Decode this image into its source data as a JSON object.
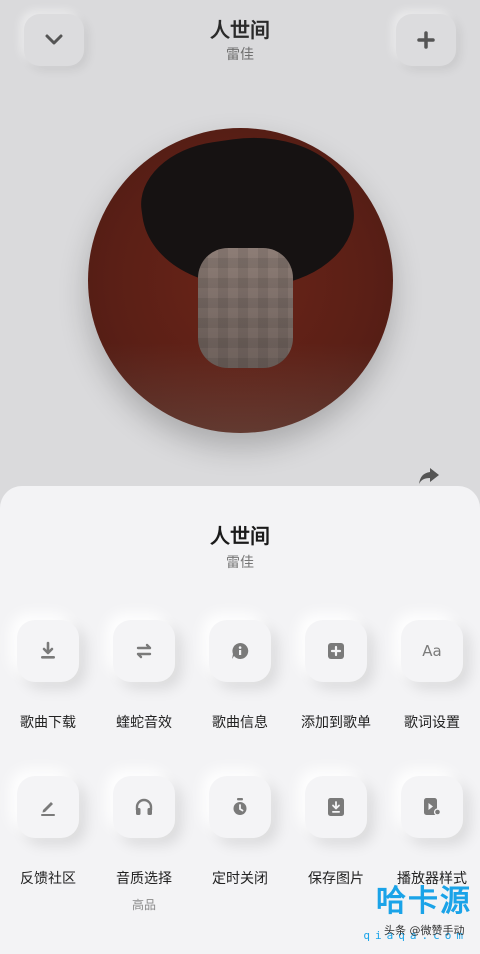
{
  "player": {
    "title": "人世间",
    "artist": "雷佳"
  },
  "sheet": {
    "title": "人世间",
    "artist": "雷佳",
    "row1": [
      {
        "label": "歌曲下载",
        "icon": "download-icon"
      },
      {
        "label": "蝰蛇音效",
        "icon": "sound-effect-icon"
      },
      {
        "label": "歌曲信息",
        "icon": "info-icon"
      },
      {
        "label": "添加到歌单",
        "icon": "add-to-playlist-icon"
      },
      {
        "label": "歌词设置",
        "icon": "lyrics-font-icon",
        "glyph": "Aa"
      }
    ],
    "row2": [
      {
        "label": "反馈社区",
        "icon": "edit-icon"
      },
      {
        "label": "音质选择",
        "icon": "headphones-icon",
        "sub": "高品"
      },
      {
        "label": "定时关闭",
        "icon": "timer-icon"
      },
      {
        "label": "保存图片",
        "icon": "save-image-icon"
      },
      {
        "label": "播放器样式",
        "icon": "player-style-icon"
      }
    ]
  },
  "watermark": {
    "logo": "哈卡源",
    "url": "qiaqa.com",
    "credit": "头条 @微赞手动"
  },
  "colors": {
    "sheet_bg": "#f3f3f5",
    "icon_gray": "#7a7a7a",
    "watermark_blue": "#1aa3e8"
  }
}
